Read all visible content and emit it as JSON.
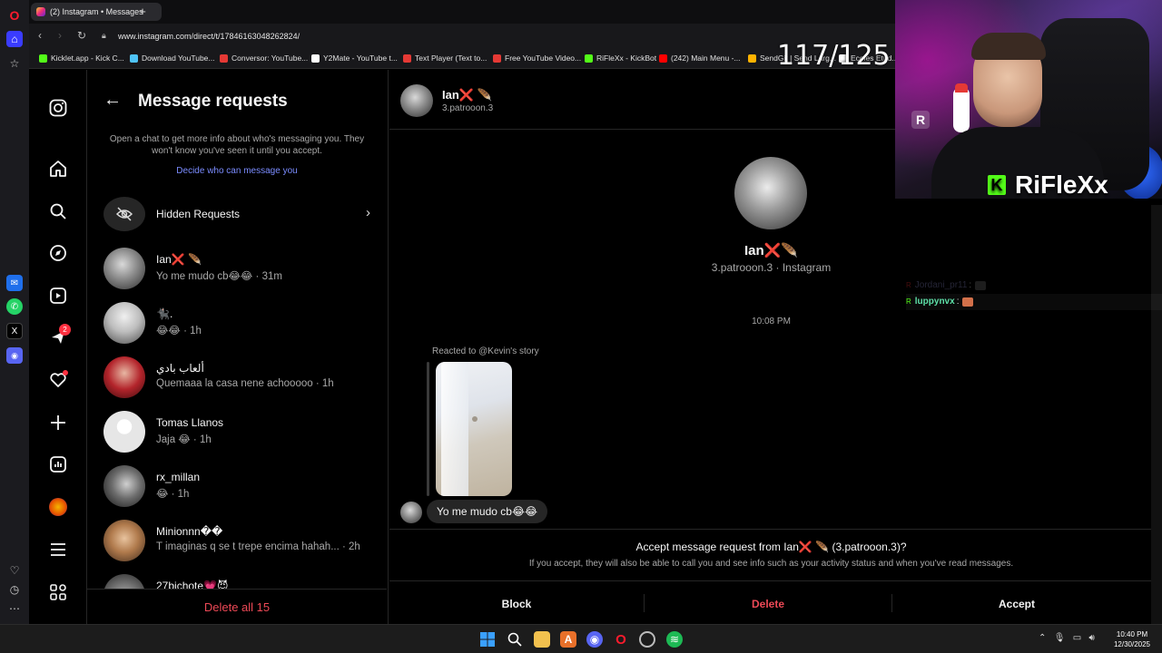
{
  "browser": {
    "tab_title": "(2) Instagram • Messages",
    "new_tab": "+",
    "url": "www.instagram.com/direct/t/17846163048262824/",
    "bookmarks": [
      {
        "label": "Kicklet.app - Kick C...",
        "color": "#53fc18"
      },
      {
        "label": "Download YouTube...",
        "color": "#4fc3f7"
      },
      {
        "label": "Conversor: YouTube...",
        "color": "#e53935"
      },
      {
        "label": "Y2Mate - YouTube t...",
        "color": "#ffffff"
      },
      {
        "label": "Text Player (Text to...",
        "color": "#e53935"
      },
      {
        "label": "Free YouTube Video...",
        "color": "#e53935"
      },
      {
        "label": "RiFleXx - KickBot",
        "color": "#53fc18"
      },
      {
        "label": "(242) Main Menu -...",
        "color": "#ff0000"
      },
      {
        "label": "SendGit | Send Larg...",
        "color": "#ffb300"
      },
      {
        "label": "Ecoles Etud...",
        "color": "#ffffff"
      }
    ]
  },
  "ig_nav": {
    "notification_count": "2"
  },
  "requests": {
    "title": "Message requests",
    "description": "Open a chat to get more info about who's messaging you. They won't know you've seen it until you accept.",
    "link": "Decide who can message you",
    "hidden_label": "Hidden Requests",
    "items": [
      {
        "name": "Ian❌ 🪶",
        "preview": "Yo me mudo cb😂😂 · 31m",
        "avatar": "#8a8a8a"
      },
      {
        "name": "🐈‍⬛.",
        "preview": "😂😂 · 1h",
        "avatar": "#c9c9c9"
      },
      {
        "name": "ألعاب بادي",
        "preview": "Quemaaa la casa nene achooooo · 1h",
        "avatar": "#b3242b"
      },
      {
        "name": "Tomas Llanos",
        "preview": "Jaja 😂 · 1h",
        "avatar": "#e6e6e6"
      },
      {
        "name": "rx_millan",
        "preview": "😂 · 1h",
        "avatar": "#555555"
      },
      {
        "name": "Minionnn��",
        "preview": "T imaginas q se t trepe encima hahah... · 2h",
        "avatar": "#b07a4c"
      },
      {
        "name": "27bichote💗😈",
        "preview": "",
        "avatar": "#777777"
      }
    ],
    "delete_all": "Delete all 15"
  },
  "conversation": {
    "header_name": "Ian❌ 🪶",
    "header_user": "3.patrooon.3",
    "profile_name": "Ian❌🪶",
    "profile_sub": "3.patrooon.3 · Instagram",
    "time": "10:08 PM",
    "reacted": "Reacted to @Kevin's story",
    "message": "Yo me mudo cb😂😂",
    "accept_question": "Accept message request from Ian❌ 🪶 (3.patrooon.3)?",
    "accept_info": "If you accept, they will also be able to call you and see info such as your activity status and when you've read messages.",
    "block": "Block",
    "delete": "Delete",
    "accept": "Accept"
  },
  "overlay": {
    "counter": "117/125",
    "streamer": "RiFleXx",
    "chat": [
      {
        "user": "Jordani_pr11",
        "sep": ":",
        "color": "#6a6a9a",
        "dim": true
      },
      {
        "user": "luppynvx",
        "sep": ":",
        "color": "#5ee0a8",
        "dim": false
      }
    ]
  },
  "taskbar": {
    "time": "10:40 PM",
    "date": "12/30/2025"
  },
  "colors": {
    "accent_blue": "#7b8cff",
    "danger": "#ed4956",
    "kick_green": "#53fc18"
  }
}
